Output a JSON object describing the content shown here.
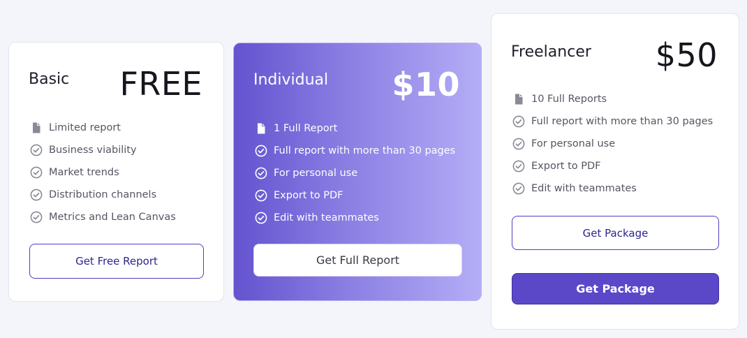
{
  "colors": {
    "page_background": "#f4f5fa",
    "accent": "#5b48c8",
    "individual_gradient_start": "#6453cf",
    "individual_gradient_end": "#b4adf6",
    "icon_gray": "#8a8a96"
  },
  "plans": [
    {
      "name": "Basic",
      "price": "FREE",
      "features": [
        {
          "icon": "document-icon",
          "label": "Limited report"
        },
        {
          "icon": "check-circle-icon",
          "label": "Business viability"
        },
        {
          "icon": "check-circle-icon",
          "label": "Market trends"
        },
        {
          "icon": "check-circle-icon",
          "label": "Distribution channels"
        },
        {
          "icon": "check-circle-icon",
          "label": "Metrics and Lean Canvas"
        }
      ],
      "buttons": [
        {
          "label": "Get Free Report"
        }
      ]
    },
    {
      "name": "Individual",
      "price": "$10",
      "features": [
        {
          "icon": "document-icon",
          "label": "1 Full Report"
        },
        {
          "icon": "check-circle-icon",
          "label": "Full report with more than 30 pages"
        },
        {
          "icon": "check-circle-icon",
          "label": "For personal use"
        },
        {
          "icon": "check-circle-icon",
          "label": "Export to PDF"
        },
        {
          "icon": "check-circle-icon",
          "label": "Edit with teammates"
        }
      ],
      "buttons": [
        {
          "label": "Get Full Report"
        }
      ]
    },
    {
      "name": "Freelancer",
      "price": "$50",
      "features": [
        {
          "icon": "document-icon",
          "label": "10 Full Reports"
        },
        {
          "icon": "check-circle-icon",
          "label": "Full report with more than 30 pages"
        },
        {
          "icon": "check-circle-icon",
          "label": "For personal use"
        },
        {
          "icon": "check-circle-icon",
          "label": "Export to PDF"
        },
        {
          "icon": "check-circle-icon",
          "label": "Edit with teammates"
        }
      ],
      "buttons": [
        {
          "label": "Get Package"
        },
        {
          "label": "Get Package"
        }
      ]
    }
  ]
}
